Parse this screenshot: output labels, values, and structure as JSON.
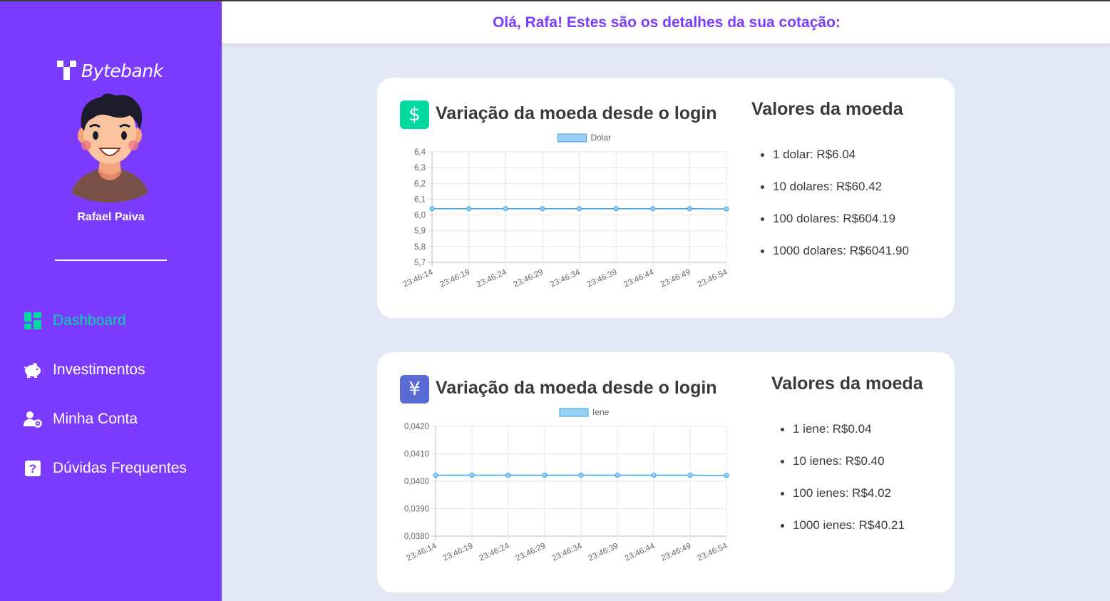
{
  "app": {
    "brand": "Bytebank",
    "user_name": "Rafael Paiva",
    "greeting": "Olá, Rafa! Estes são os detalhes da sua cotação:"
  },
  "colors": {
    "sidebar_bg": "#7b3cff",
    "accent_green": "#00d9a0",
    "dollar_badge": "#00d9a0",
    "yen_badge": "#5b6bd6",
    "chart_line": "#36a2eb",
    "chart_fill": "#9ad0f5"
  },
  "nav": [
    {
      "label": "Dashboard",
      "icon": "dashboard-icon",
      "active": true
    },
    {
      "label": "Investimentos",
      "icon": "piggy-bank-icon",
      "active": false
    },
    {
      "label": "Minha Conta",
      "icon": "user-gear-icon",
      "active": false
    },
    {
      "label": "Dúvidas Frequentes",
      "icon": "question-icon",
      "active": false
    }
  ],
  "cards": [
    {
      "badge": "$",
      "badge_icon": "dollar-icon",
      "title": "Variação da moeda desde o login",
      "values_title": "Valores da moeda",
      "values": [
        "1 dolar: R$6.04",
        "10 dolares: R$60.42",
        "100 dolares: R$604.19",
        "1000 dolares: R$6041.90"
      ]
    },
    {
      "badge": "¥",
      "badge_icon": "yen-icon",
      "title": "Variação da moeda desde o login",
      "values_title": "Valores da moeda",
      "values": [
        "1 iene: R$0.04",
        "10 ienes: R$0.40",
        "100 ienes: R$4.02",
        "1000 ienes: R$40.21"
      ]
    }
  ],
  "chart_data": [
    {
      "type": "line",
      "legend": "top-center",
      "grid": true,
      "x": [
        "23:46:14",
        "23:46:19",
        "23:46:24",
        "23:46:29",
        "23:46:34",
        "23:46:39",
        "23:46:44",
        "23:46:49",
        "23:46:54"
      ],
      "series": [
        {
          "name": "Dólar",
          "values": [
            6.04,
            6.04,
            6.04,
            6.04,
            6.04,
            6.04,
            6.04,
            6.04,
            6.038
          ]
        }
      ],
      "yticks": [
        "6,4",
        "6,3",
        "6,2",
        "6,1",
        "6,0",
        "5,9",
        "5,8",
        "5,7"
      ],
      "ylim": [
        5.7,
        6.4
      ]
    },
    {
      "type": "line",
      "legend": "top-center",
      "grid": true,
      "x": [
        "23:46:14",
        "23:46:19",
        "23:46:24",
        "23:46:29",
        "23:46:34",
        "23:46:39",
        "23:46:44",
        "23:46:49",
        "23:46:54"
      ],
      "series": [
        {
          "name": "Iene",
          "values": [
            0.04022,
            0.04022,
            0.04022,
            0.04022,
            0.04022,
            0.04022,
            0.04022,
            0.04022,
            0.04021
          ]
        }
      ],
      "yticks": [
        "0,0420",
        "0,0410",
        "0,0400",
        "0,0390",
        "0,0380"
      ],
      "ylim": [
        0.038,
        0.042
      ]
    }
  ]
}
